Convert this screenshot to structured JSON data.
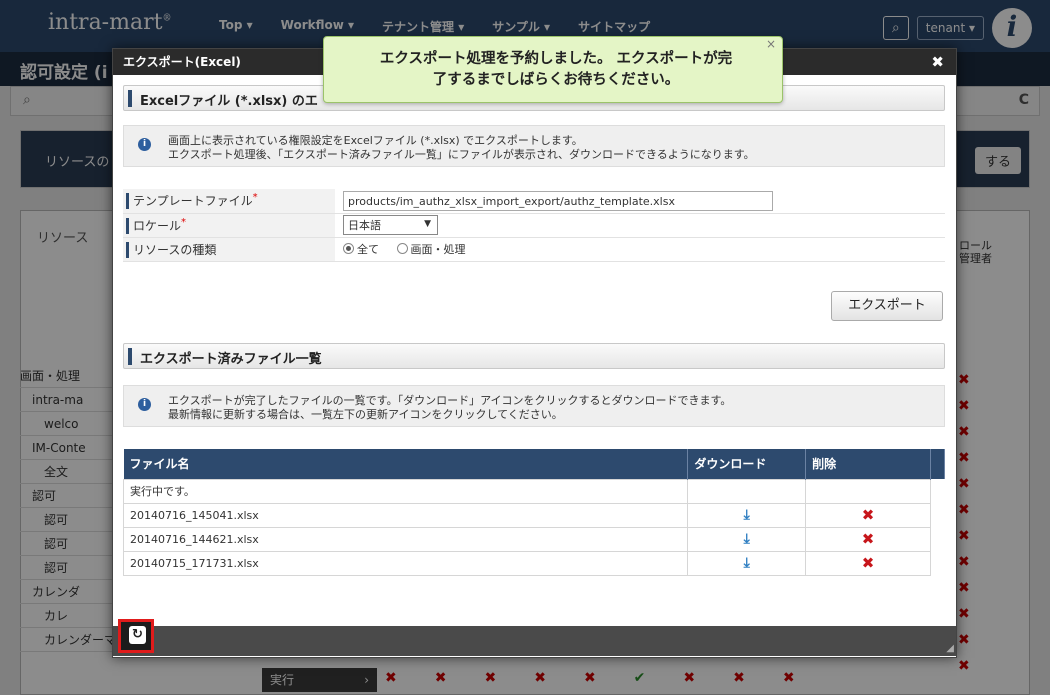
{
  "app": {
    "logo": "intra-mart",
    "nav": [
      "Top ▾",
      "Workflow ▾",
      "テナント管理 ▾",
      "サンプル ▾",
      "サイトマップ"
    ],
    "user": "tenant ▾",
    "page_title": "認可設定 (i",
    "resources_label": "リソースの",
    "resources_action": "する",
    "grid_header": "リソース",
    "role_column": "ロール管理者",
    "tree_rows": [
      "画面・処理",
      "intra-ma",
      "welco",
      "IM-Conte",
      "全文",
      "認可",
      "認可",
      "認可",
      "認可",
      "カレンダ",
      "カレ",
      "カレンダーマージ設定"
    ],
    "exec_label": "実行"
  },
  "modal": {
    "title": "エクスポート(Excel)",
    "section1_title": "Excelファイル (*.xlsx) のエ",
    "info1_line1": "画面上に表示されている権限設定をExcelファイル (*.xlsx) でエクスポートします。",
    "info1_line2": "エクスポート処理後、「エクスポート済みファイル一覧」にファイルが表示され、ダウンロードできるようになります。",
    "form": {
      "template_label": "テンプレートファイル",
      "template_value": "products/im_authz_xlsx_import_export/authz_template.xlsx",
      "locale_label": "ロケール",
      "locale_value": "日本語",
      "resource_type_label": "リソースの種類",
      "radio_all": "全て",
      "radio_screen": "画面・処理",
      "required_mark": "*"
    },
    "export_button": "エクスポート",
    "section2_title": "エクスポート済みファイル一覧",
    "info2_line1": "エクスポートが完了したファイルの一覧です。「ダウンロード」アイコンをクリックするとダウンロードできます。",
    "info2_line2": "最新情報に更新する場合は、一覧左下の更新アイコンをクリックしてください。",
    "table": {
      "col_filename": "ファイル名",
      "col_download": "ダウンロード",
      "col_delete": "削除",
      "rows": [
        {
          "name": "実行中です。",
          "done": false
        },
        {
          "name": "20140716_145041.xlsx",
          "done": true
        },
        {
          "name": "20140716_144621.xlsx",
          "done": true
        },
        {
          "name": "20140715_171731.xlsx",
          "done": true
        }
      ]
    }
  },
  "toast": {
    "line1": "エクスポート処理を予約しました。 エクスポートが完",
    "line2": "了するまでしばらくお待ちください。"
  },
  "icons": {
    "download": "download-icon",
    "delete": "delete-icon",
    "refresh": "refresh-icon",
    "info": "info-icon",
    "close": "close-icon"
  },
  "colors": {
    "header_blue": "#2d4a6e",
    "toast_bg": "#e4f5c6",
    "delete_red": "#c7161b",
    "highlight_red": "#e01b1b"
  }
}
